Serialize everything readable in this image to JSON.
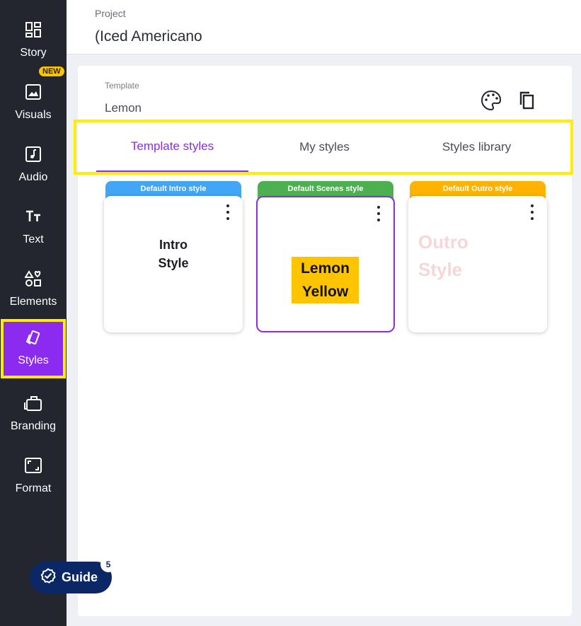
{
  "sidebar": {
    "items": [
      {
        "label": "Story",
        "icon": "dashboard-icon"
      },
      {
        "label": "Visuals",
        "icon": "image-icon",
        "badge": "NEW"
      },
      {
        "label": "Audio",
        "icon": "music-note-icon"
      },
      {
        "label": "Text",
        "icon": "text-icon"
      },
      {
        "label": "Elements",
        "icon": "shapes-icon"
      },
      {
        "label": "Styles",
        "icon": "styles-icon",
        "active": true
      },
      {
        "label": "Branding",
        "icon": "briefcase-icon"
      },
      {
        "label": "Format",
        "icon": "aspect-ratio-icon"
      }
    ]
  },
  "header": {
    "project_label": "Project",
    "project_name": "(Iced Americano"
  },
  "panel": {
    "template_label": "Template",
    "template_name": "Lemon",
    "tabs": [
      {
        "label": "Template styles",
        "active": true
      },
      {
        "label": "My styles"
      },
      {
        "label": "Styles library"
      }
    ],
    "cards": [
      {
        "tag": "Default Intro style",
        "tag_color": "#42a5f5",
        "preview_text": "Intro\nStyle"
      },
      {
        "tag": "Default Scenes style",
        "tag_color": "#4caf50",
        "preview_text": "Lemon\nYellow",
        "selected": true
      },
      {
        "tag": "Default Outro style",
        "tag_color": "#ffb300",
        "preview_text": "Outro\nStyle"
      }
    ]
  },
  "guide": {
    "label": "Guide",
    "count": "5"
  },
  "colors": {
    "accent": "#8c2bf0",
    "sidebar_bg": "#23252f",
    "highlight": "#ffee00",
    "lemon": "#ffc400"
  }
}
